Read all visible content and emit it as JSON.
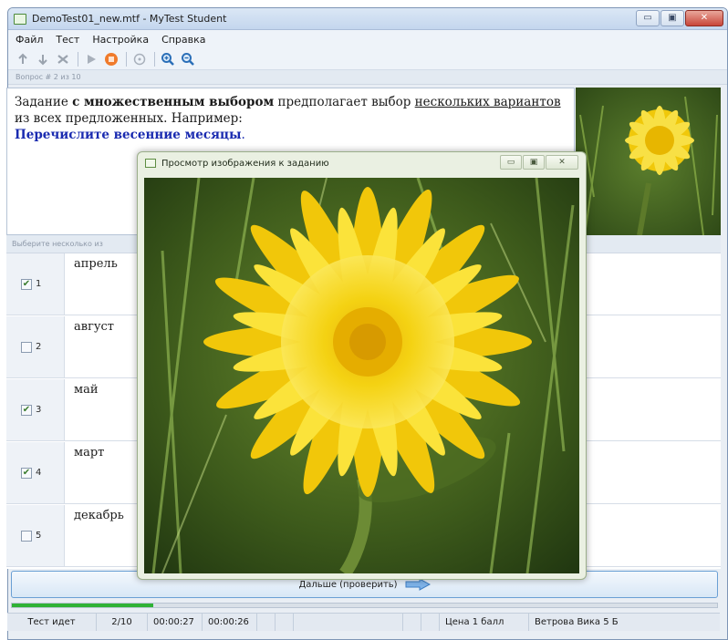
{
  "window": {
    "title": "DemoTest01_new.mtf - MyTest Student",
    "controls": {
      "minimize": "▭",
      "maximize": "▣",
      "close": "✕"
    }
  },
  "menu": [
    "Файл",
    "Тест",
    "Настройка",
    "Справка"
  ],
  "toolbar": {
    "icons": [
      "arrow-up-icon",
      "arrow-down-icon",
      "shuffle-icon",
      "play-icon",
      "stop-icon",
      "help-icon",
      "zoom-in-icon",
      "zoom-out-icon"
    ]
  },
  "question_label": "Вопрос # 2 из 10",
  "task": {
    "w1": "Задание",
    "b1": "с множественным выбором",
    "w2": "предполагает выбор",
    "u1": "нескольких вариантов",
    "w3": "из всех предложенных. Например:",
    "example": "Перечислите весенние месяцы",
    "example_end": "."
  },
  "hint_label": "Выберите несколько из",
  "answers": [
    {
      "num": "1",
      "text": "апрель",
      "checked": true
    },
    {
      "num": "2",
      "text": "август",
      "checked": false
    },
    {
      "num": "3",
      "text": "май",
      "checked": true
    },
    {
      "num": "4",
      "text": "март",
      "checked": true
    },
    {
      "num": "5",
      "text": "декабрь",
      "checked": false
    }
  ],
  "next_button": "Дальше (проверить)",
  "progress": {
    "fraction": 0.2
  },
  "status": {
    "state": "Тест идет",
    "question": "2/10",
    "time_total": "00:00:27",
    "time_question": "00:00:26",
    "price": "Цена 1 балл",
    "student": "Ветрова Вика 5 Б"
  },
  "image_dialog": {
    "title": "Просмотр изображения к заданию",
    "controls": {
      "minimize": "▭",
      "maximize": "▣",
      "close": "✕"
    }
  },
  "colors": {
    "accent": "#1a2bb0",
    "progress": "#2fb236",
    "flower": "#f4d20e"
  }
}
